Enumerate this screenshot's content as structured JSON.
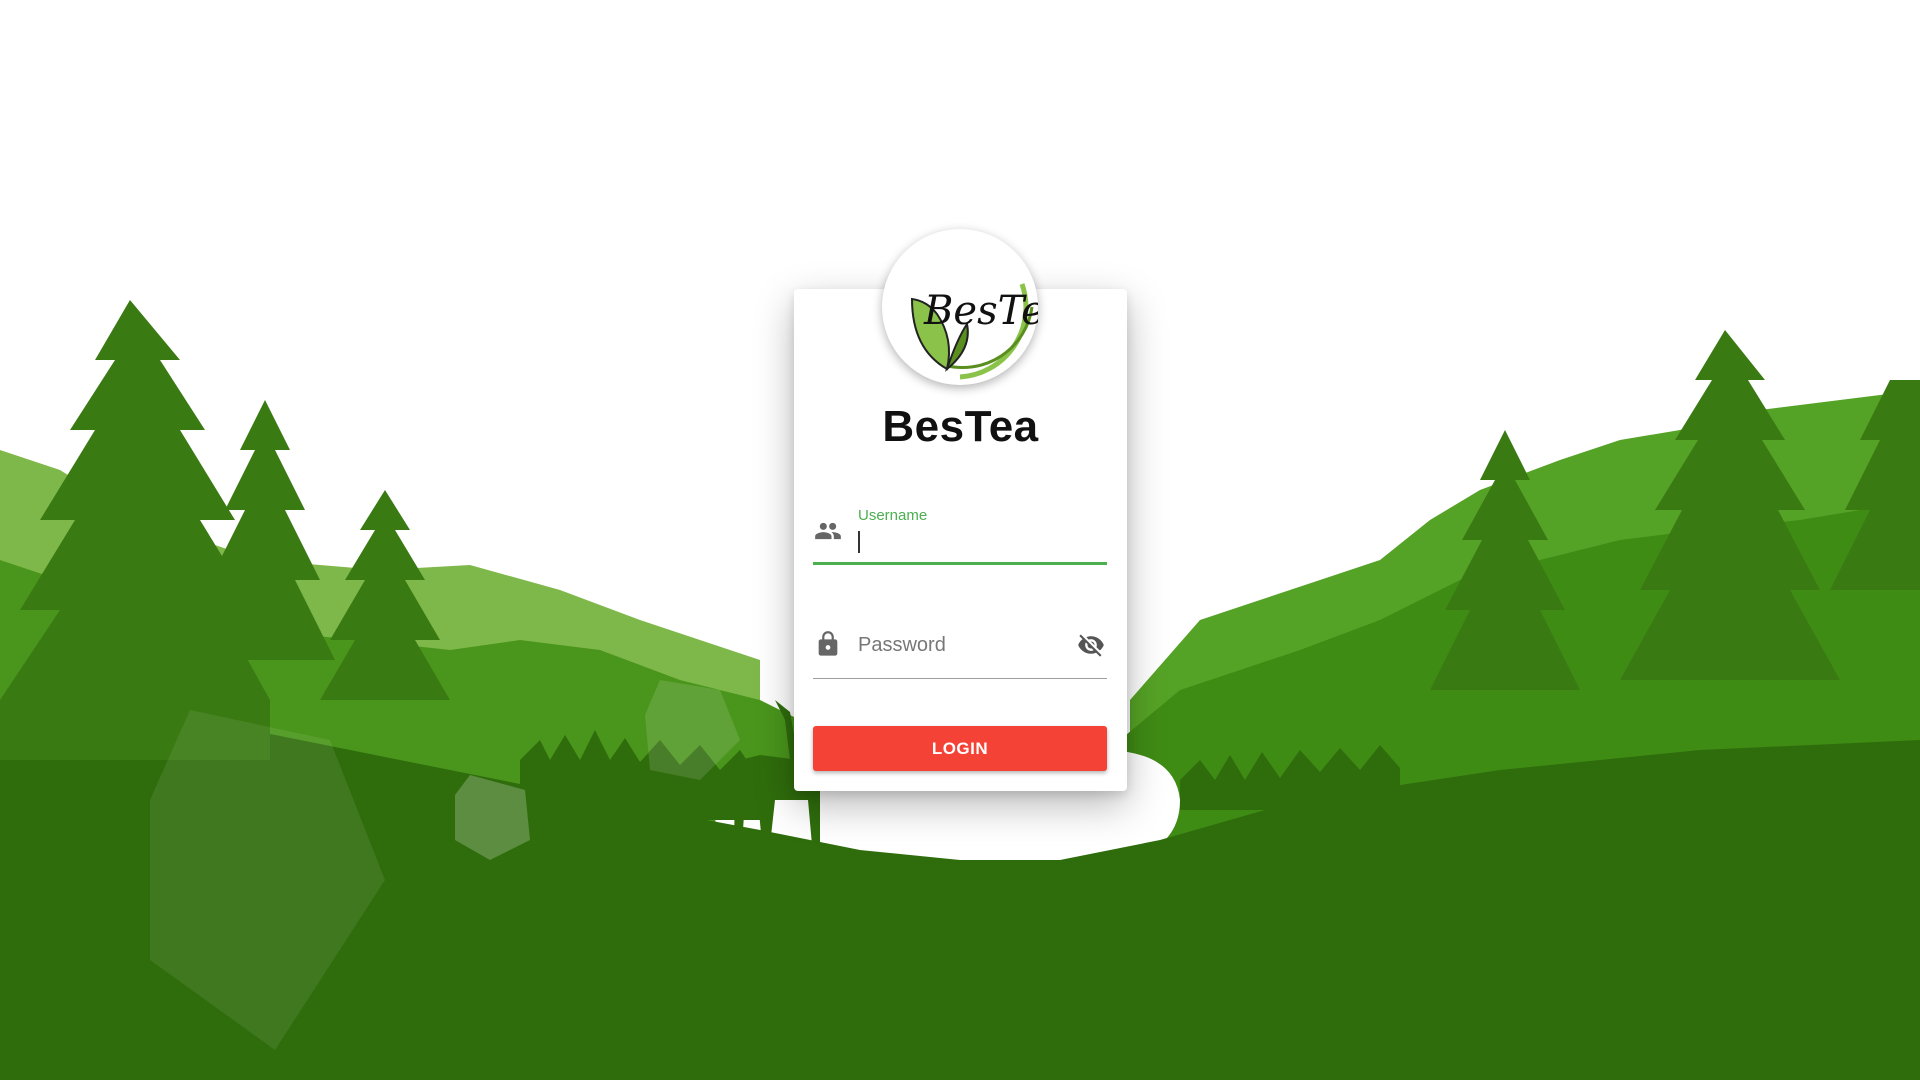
{
  "brand": {
    "title": "BesTea",
    "logo_text": "BesTea",
    "logo_icon": "tea-leaf-logo"
  },
  "form": {
    "username": {
      "label": "Username",
      "value": "",
      "icon": "people-icon",
      "focused": true
    },
    "password": {
      "placeholder": "Password",
      "value": "",
      "icon": "lock-icon",
      "toggle_icon": "eye-off-icon"
    },
    "login_label": "LOGIN"
  },
  "colors": {
    "accent": "#4caf50",
    "button": "#f44336",
    "forest_dark": "#2e6a0c",
    "forest_mid": "#4a9a1a",
    "forest_light": "#7ab648"
  }
}
